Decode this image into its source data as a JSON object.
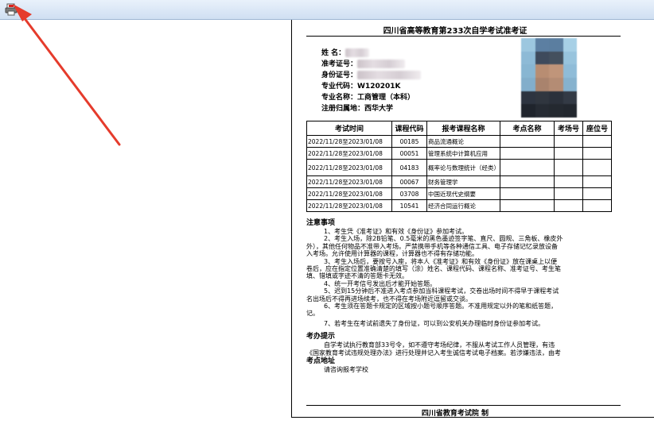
{
  "toolbar": {
    "print_icon": "print-pdf-icon"
  },
  "colors": {
    "arrow": "#e53b2c",
    "toolbar": "#d9e6f5"
  },
  "doc": {
    "title": "四川省高等教育第233次自学考试准考证",
    "info": [
      {
        "label": "姓    名：",
        "value": ""
      },
      {
        "label": "准考证号：",
        "value": ""
      },
      {
        "label": "身份证号：",
        "value": ""
      },
      {
        "label": "专业代码：",
        "value": "W120201K"
      },
      {
        "label": "专业名称：",
        "value": "工商管理（本科）"
      },
      {
        "label": "注册归属地：",
        "value": "西华大学"
      }
    ],
    "table": {
      "headers": [
        "考试时间",
        "课程代码",
        "报考课程名称",
        "考点名称",
        "考场号",
        "座位号"
      ],
      "rows": [
        [
          "2022/11/28至2023/01/08",
          "00185",
          "商品流通概论",
          "",
          "",
          ""
        ],
        [
          "2022/11/28至2023/01/08",
          "00051",
          "管理系统中计算机应用",
          "",
          "",
          ""
        ],
        [
          "2022/11/28至2023/01/08",
          "04183",
          "概率论与数理统计（经类）",
          "",
          "",
          ""
        ],
        [
          "2022/11/28至2023/01/08",
          "00067",
          "财务管理学",
          "",
          "",
          ""
        ],
        [
          "2022/11/28至2023/01/08",
          "03708",
          "中国近现代史纲要",
          "",
          "",
          ""
        ],
        [
          "2022/11/28至2023/01/08",
          "10541",
          "经济合同运行概论",
          "",
          "",
          ""
        ]
      ]
    },
    "notes": {
      "heading": "注意事项",
      "lines": [
        "1、考生凭《准考证》和有效《身份证》参加考试。",
        "2、考生入场，除2B铅笔、0.5毫米的黑色墨迹签字笔、直尺、圆规、三角板、橡皮外",
        "外），其他任何物品不准带入考场。严禁携带手机等各种通信工具、电子存储记忆录放设备",
        "入考场。允许使用计算器的课程，计算器也不得有存储功能。",
        "3、考生入场后，要按号入座，将本人《准考证》和有效《身份证》放在课桌上以便",
        "卷后，应在指定位置准确清楚的填写（涂）姓名、课程代码、课程名称、准考证号、考生笔",
        "填、错填或字迹不清的答题卡无效。",
        "4、统一开考信号发出后才能开始答题。",
        "5、迟到15分钟后不准进入考点参加当科课程考试，交卷出场时间不得早于课程考试",
        "名出场后不得再进场续考，也不得在考场附近逗留或交谈。",
        "6、考生须在答题卡规定的区域按小题号顺序答题。不准用规定以外的笔和纸答题，",
        "记。",
        "7、若考生在考试前遗失了身份证，可以到公安机关办理临时身份证参加考试。"
      ]
    },
    "exam_office": {
      "heading": "考办提示",
      "lines": [
        "自学考试执行教育部33号令，如不遵守考场纪律，不服从考试工作人员管理，有违",
        "《国家教育考试违规处理办法》进行处理并记入考生诚信考试电子档案。若涉嫌违法，由考"
      ]
    },
    "address": {
      "heading": "考点地址",
      "value": "请咨询报考学校"
    },
    "footer": "四川省教育考试院    制"
  }
}
